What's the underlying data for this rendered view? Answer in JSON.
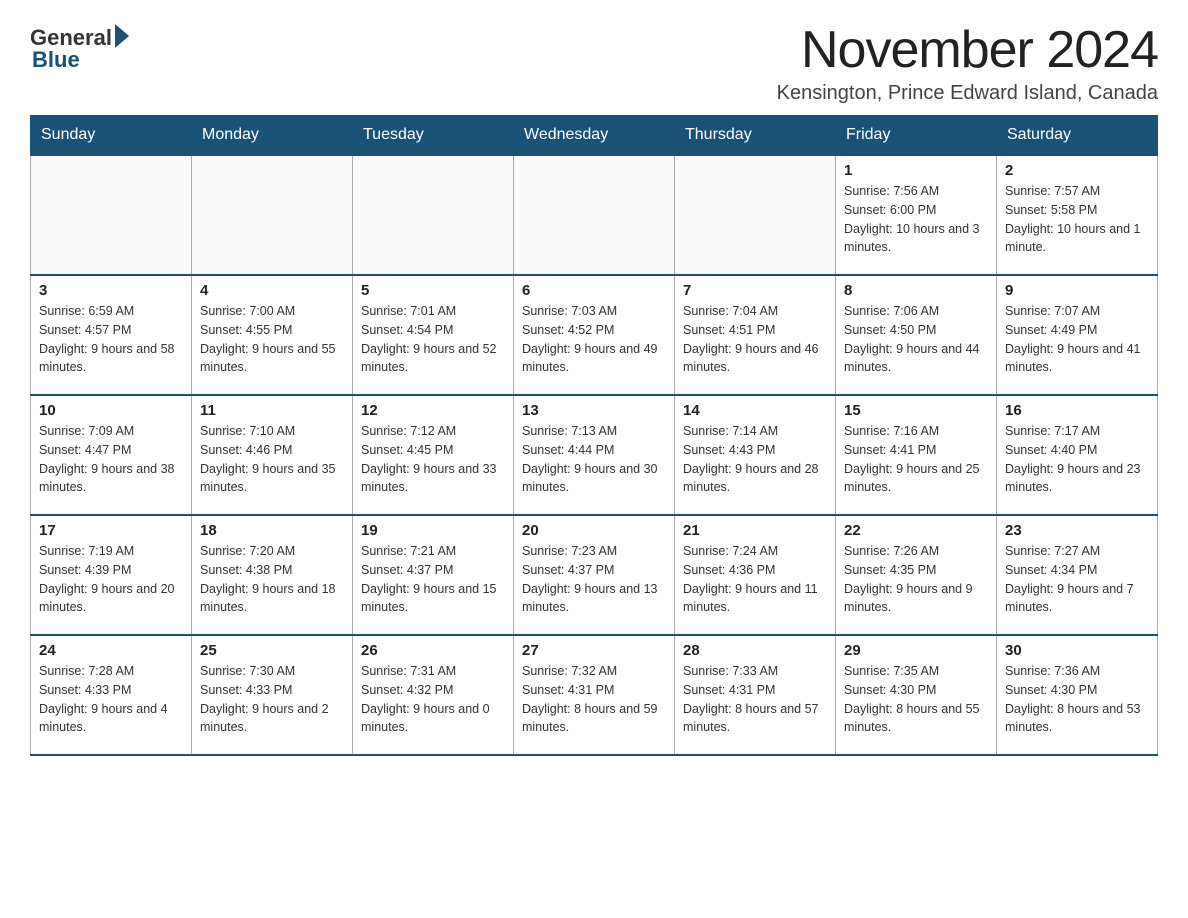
{
  "logo": {
    "general": "General",
    "blue": "Blue"
  },
  "title": "November 2024",
  "subtitle": "Kensington, Prince Edward Island, Canada",
  "weekdays": [
    "Sunday",
    "Monday",
    "Tuesday",
    "Wednesday",
    "Thursday",
    "Friday",
    "Saturday"
  ],
  "weeks": [
    [
      {
        "day": "",
        "info": ""
      },
      {
        "day": "",
        "info": ""
      },
      {
        "day": "",
        "info": ""
      },
      {
        "day": "",
        "info": ""
      },
      {
        "day": "",
        "info": ""
      },
      {
        "day": "1",
        "info": "Sunrise: 7:56 AM\nSunset: 6:00 PM\nDaylight: 10 hours and 3 minutes."
      },
      {
        "day": "2",
        "info": "Sunrise: 7:57 AM\nSunset: 5:58 PM\nDaylight: 10 hours and 1 minute."
      }
    ],
    [
      {
        "day": "3",
        "info": "Sunrise: 6:59 AM\nSunset: 4:57 PM\nDaylight: 9 hours and 58 minutes."
      },
      {
        "day": "4",
        "info": "Sunrise: 7:00 AM\nSunset: 4:55 PM\nDaylight: 9 hours and 55 minutes."
      },
      {
        "day": "5",
        "info": "Sunrise: 7:01 AM\nSunset: 4:54 PM\nDaylight: 9 hours and 52 minutes."
      },
      {
        "day": "6",
        "info": "Sunrise: 7:03 AM\nSunset: 4:52 PM\nDaylight: 9 hours and 49 minutes."
      },
      {
        "day": "7",
        "info": "Sunrise: 7:04 AM\nSunset: 4:51 PM\nDaylight: 9 hours and 46 minutes."
      },
      {
        "day": "8",
        "info": "Sunrise: 7:06 AM\nSunset: 4:50 PM\nDaylight: 9 hours and 44 minutes."
      },
      {
        "day": "9",
        "info": "Sunrise: 7:07 AM\nSunset: 4:49 PM\nDaylight: 9 hours and 41 minutes."
      }
    ],
    [
      {
        "day": "10",
        "info": "Sunrise: 7:09 AM\nSunset: 4:47 PM\nDaylight: 9 hours and 38 minutes."
      },
      {
        "day": "11",
        "info": "Sunrise: 7:10 AM\nSunset: 4:46 PM\nDaylight: 9 hours and 35 minutes."
      },
      {
        "day": "12",
        "info": "Sunrise: 7:12 AM\nSunset: 4:45 PM\nDaylight: 9 hours and 33 minutes."
      },
      {
        "day": "13",
        "info": "Sunrise: 7:13 AM\nSunset: 4:44 PM\nDaylight: 9 hours and 30 minutes."
      },
      {
        "day": "14",
        "info": "Sunrise: 7:14 AM\nSunset: 4:43 PM\nDaylight: 9 hours and 28 minutes."
      },
      {
        "day": "15",
        "info": "Sunrise: 7:16 AM\nSunset: 4:41 PM\nDaylight: 9 hours and 25 minutes."
      },
      {
        "day": "16",
        "info": "Sunrise: 7:17 AM\nSunset: 4:40 PM\nDaylight: 9 hours and 23 minutes."
      }
    ],
    [
      {
        "day": "17",
        "info": "Sunrise: 7:19 AM\nSunset: 4:39 PM\nDaylight: 9 hours and 20 minutes."
      },
      {
        "day": "18",
        "info": "Sunrise: 7:20 AM\nSunset: 4:38 PM\nDaylight: 9 hours and 18 minutes."
      },
      {
        "day": "19",
        "info": "Sunrise: 7:21 AM\nSunset: 4:37 PM\nDaylight: 9 hours and 15 minutes."
      },
      {
        "day": "20",
        "info": "Sunrise: 7:23 AM\nSunset: 4:37 PM\nDaylight: 9 hours and 13 minutes."
      },
      {
        "day": "21",
        "info": "Sunrise: 7:24 AM\nSunset: 4:36 PM\nDaylight: 9 hours and 11 minutes."
      },
      {
        "day": "22",
        "info": "Sunrise: 7:26 AM\nSunset: 4:35 PM\nDaylight: 9 hours and 9 minutes."
      },
      {
        "day": "23",
        "info": "Sunrise: 7:27 AM\nSunset: 4:34 PM\nDaylight: 9 hours and 7 minutes."
      }
    ],
    [
      {
        "day": "24",
        "info": "Sunrise: 7:28 AM\nSunset: 4:33 PM\nDaylight: 9 hours and 4 minutes."
      },
      {
        "day": "25",
        "info": "Sunrise: 7:30 AM\nSunset: 4:33 PM\nDaylight: 9 hours and 2 minutes."
      },
      {
        "day": "26",
        "info": "Sunrise: 7:31 AM\nSunset: 4:32 PM\nDaylight: 9 hours and 0 minutes."
      },
      {
        "day": "27",
        "info": "Sunrise: 7:32 AM\nSunset: 4:31 PM\nDaylight: 8 hours and 59 minutes."
      },
      {
        "day": "28",
        "info": "Sunrise: 7:33 AM\nSunset: 4:31 PM\nDaylight: 8 hours and 57 minutes."
      },
      {
        "day": "29",
        "info": "Sunrise: 7:35 AM\nSunset: 4:30 PM\nDaylight: 8 hours and 55 minutes."
      },
      {
        "day": "30",
        "info": "Sunrise: 7:36 AM\nSunset: 4:30 PM\nDaylight: 8 hours and 53 minutes."
      }
    ]
  ]
}
